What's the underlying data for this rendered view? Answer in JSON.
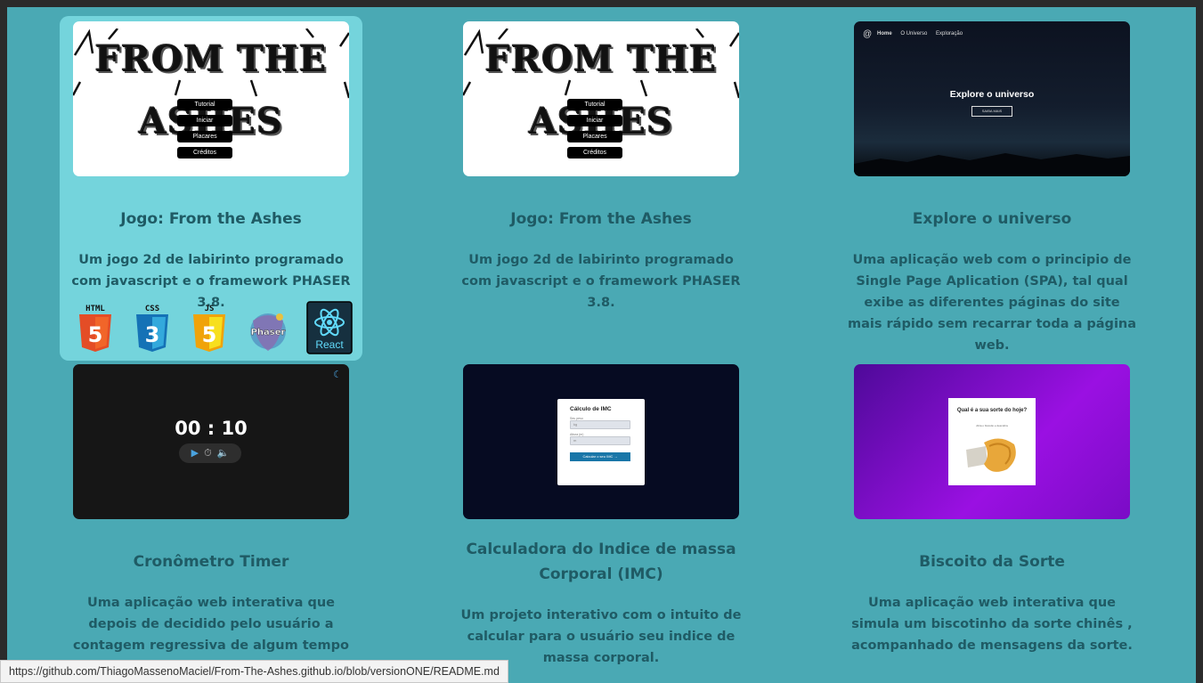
{
  "projects": [
    {
      "title": "Jogo: From the Ashes",
      "description": "Um jogo 2d de labirinto programado com javascript e o framework PHASER 3.8.",
      "thumb": {
        "logo": "FROM THE ASHES",
        "menu": [
          "Tutorial",
          "Iniciar",
          "Placares",
          "Créditos"
        ]
      },
      "tech": [
        "HTML",
        "CSS",
        "JS",
        "Phaser",
        "React"
      ]
    },
    {
      "title": "Jogo: From the Ashes",
      "description": "Um jogo 2d de labirinto programado com javascript e o framework PHASER 3.8.",
      "thumb": {
        "logo": "FROM THE ASHES",
        "menu": [
          "Tutorial",
          "Iniciar",
          "Placares",
          "Créditos"
        ]
      }
    },
    {
      "title": "Explore o universo",
      "description": "Uma aplicação web com o principio de Single Page Aplication (SPA), tal qual exibe as diferentes páginas do site mais rápido sem recarrar toda a página web.",
      "thumb": {
        "nav": [
          "Home",
          "O Universo",
          "Exploração"
        ],
        "heading": "Explore o universo",
        "button": "SAIBA MAIS"
      }
    },
    {
      "title": "Cronômetro Timer",
      "description": "Uma aplicação web interativa que depois de decidido pelo usuário a contagem regressiva de algum tempo em minutos é disparado um alarme. E acompanhado",
      "thumb": {
        "time": "00 : 10"
      }
    },
    {
      "title": "Calculadora do Indice de massa Corporal (IMC)",
      "description": "Um projeto interativo com o intuito de calcular para o usuário seu indice de massa corporal.",
      "thumb": {
        "heading": "Cálculo de IMC",
        "label1": "Seu peso",
        "value1": "kg",
        "label2": "Altura (m)",
        "value2": "m",
        "button": "Calcular o seu IMC →"
      }
    },
    {
      "title": "Biscoito da Sorte",
      "description": "Uma aplicação web interativa que simula um biscotinho da sorte chinês , acompanhado de mensagens da sorte.",
      "thumb": {
        "question": "Qual é a sua sorte do hoje?",
        "hint": "Abra o biscoito e descubra"
      }
    }
  ],
  "status_url": "https://github.com/ThiagoMassenoMaciel/From-The-Ashes.github.io/blob/versionONE/README.md",
  "colors": {
    "background": "#4aa9b4",
    "hover_card": "#74d4dc",
    "text": "#1f5b65"
  },
  "icons": [
    "html5-icon",
    "css3-icon",
    "javascript-icon",
    "phaser-icon",
    "react-icon"
  ]
}
